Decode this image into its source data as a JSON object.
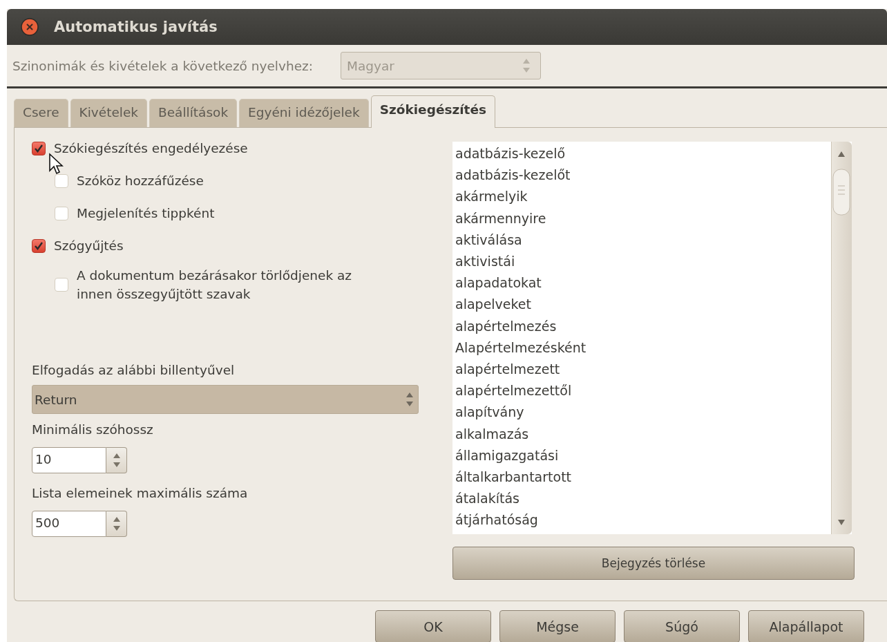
{
  "window": {
    "title": "Automatikus javítás"
  },
  "language": {
    "label": "Szinonimák és kivételek a következő nyelvhez:",
    "value": "Magyar",
    "disabled": true
  },
  "tabs": [
    {
      "label": "Csere",
      "selected": false
    },
    {
      "label": "Kivételek",
      "selected": false
    },
    {
      "label": "Beállítások",
      "selected": false
    },
    {
      "label": "Egyéni idézőjelek",
      "selected": false
    },
    {
      "label": "Szókiegészítés",
      "selected": true
    }
  ],
  "options": [
    {
      "label": "Szókiegészítés engedélyezése",
      "checked": true,
      "children": [
        {
          "label": "Szóköz hozzáfűzése",
          "checked": false
        },
        {
          "label": "Megjelenítés tippként",
          "checked": false
        }
      ]
    },
    {
      "label": "Szógyűjtés",
      "checked": true,
      "children": [
        {
          "label": "A dokumentum bezárásakor törlődjenek az innen összegyűjtött szavak",
          "checked": false
        }
      ]
    }
  ],
  "accept_key": {
    "label": "Elfogadás az alábbi billentyűvel",
    "value": "Return"
  },
  "min_word_length": {
    "label": "Minimális szóhossz",
    "value": "10"
  },
  "max_entries": {
    "label": "Lista elemeinek maximális száma",
    "value": "500"
  },
  "word_list": [
    "adatbázis-kezelő",
    "adatbázis-kezelőt",
    "akármelyik",
    "akármennyire",
    "aktiválása",
    "aktivistái",
    "alapadatokat",
    "alapelveket",
    "alapértelmezés",
    "Alapértelmezésként",
    "alapértelmezett",
    "alapértelmezettől",
    "alapítvány",
    "alkalmazás",
    "államigazgatási",
    "általkarbantartott",
    "átalakítás",
    "átjárhatóság"
  ],
  "delete_button": "Bejegyzés törlése",
  "buttons": [
    "OK",
    "Mégse",
    "Súgó",
    "Alapállapot"
  ]
}
